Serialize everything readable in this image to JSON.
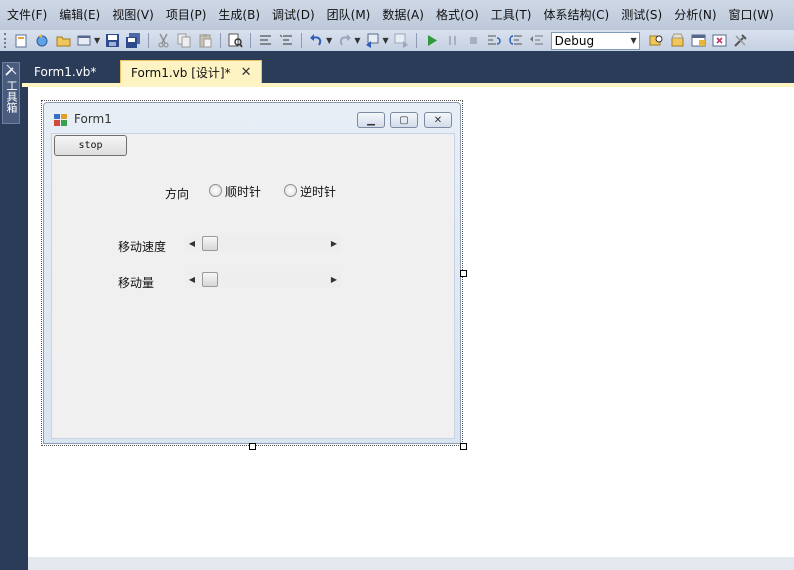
{
  "menu": [
    "文件(F)",
    "编辑(E)",
    "视图(V)",
    "项目(P)",
    "生成(B)",
    "调试(D)",
    "团队(M)",
    "数据(A)",
    "格式(O)",
    "工具(T)",
    "体系结构(C)",
    "测试(S)",
    "分析(N)",
    "窗口(W)"
  ],
  "toolbar": {
    "configuration": "Debug"
  },
  "toolbox": {
    "label": "工具箱"
  },
  "tabs": [
    {
      "label": "Form1.vb*",
      "active": false
    },
    {
      "label": "Form1.vb [设计]*",
      "active": true
    }
  ],
  "form": {
    "title": "Form1",
    "button_stop": "stop",
    "direction_label": "方向",
    "radio_clockwise": "顺时针",
    "radio_counterclockwise": "逆时针",
    "speed_label": "移动速度",
    "amount_label": "移动量"
  },
  "colors": {
    "accent_tab": "#fdf3c3",
    "ide_background": "#2b3c59"
  }
}
